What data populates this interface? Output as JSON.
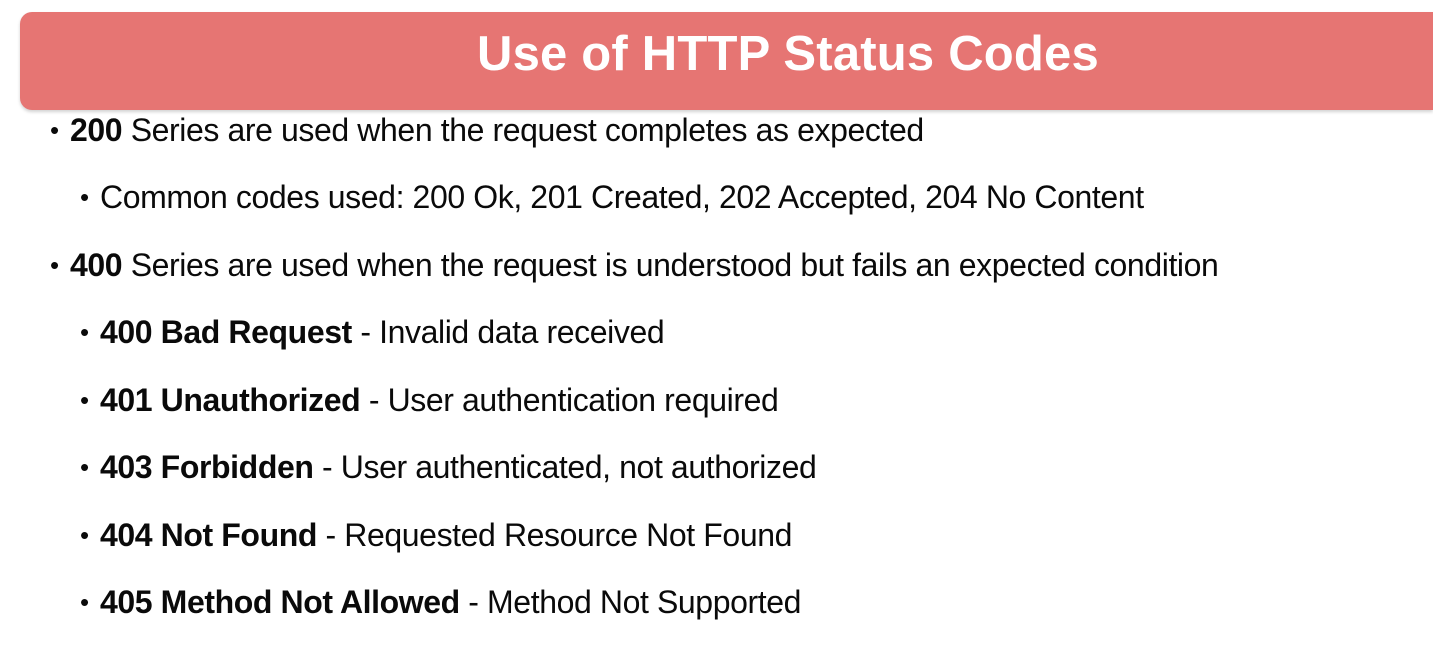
{
  "slide": {
    "title": "Use of HTTP Status Codes",
    "banner_color": "#e67573",
    "bullet_glyph": "•",
    "items": [
      {
        "level": 1,
        "code": "200",
        "text": " Series are used when the request completes as expected"
      },
      {
        "level": 2,
        "code": "",
        "text": "Common codes used: 200 Ok, 201 Created, 202 Accepted, 204 No Content"
      },
      {
        "level": 1,
        "code": "400",
        "text": " Series are used when the request is understood but fails an expected condition"
      },
      {
        "level": 2,
        "code": "400 Bad Request",
        "text": " - Invalid data received"
      },
      {
        "level": 2,
        "code": "401 Unauthorized",
        "text": " - User authentication required"
      },
      {
        "level": 2,
        "code": "403 Forbidden",
        "text": " - User authenticated, not authorized"
      },
      {
        "level": 2,
        "code": "404 Not Found",
        "text": " - Requested Resource Not Found"
      },
      {
        "level": 2,
        "code": "405 Method Not Allowed",
        "text": " - Method Not Supported"
      }
    ]
  }
}
